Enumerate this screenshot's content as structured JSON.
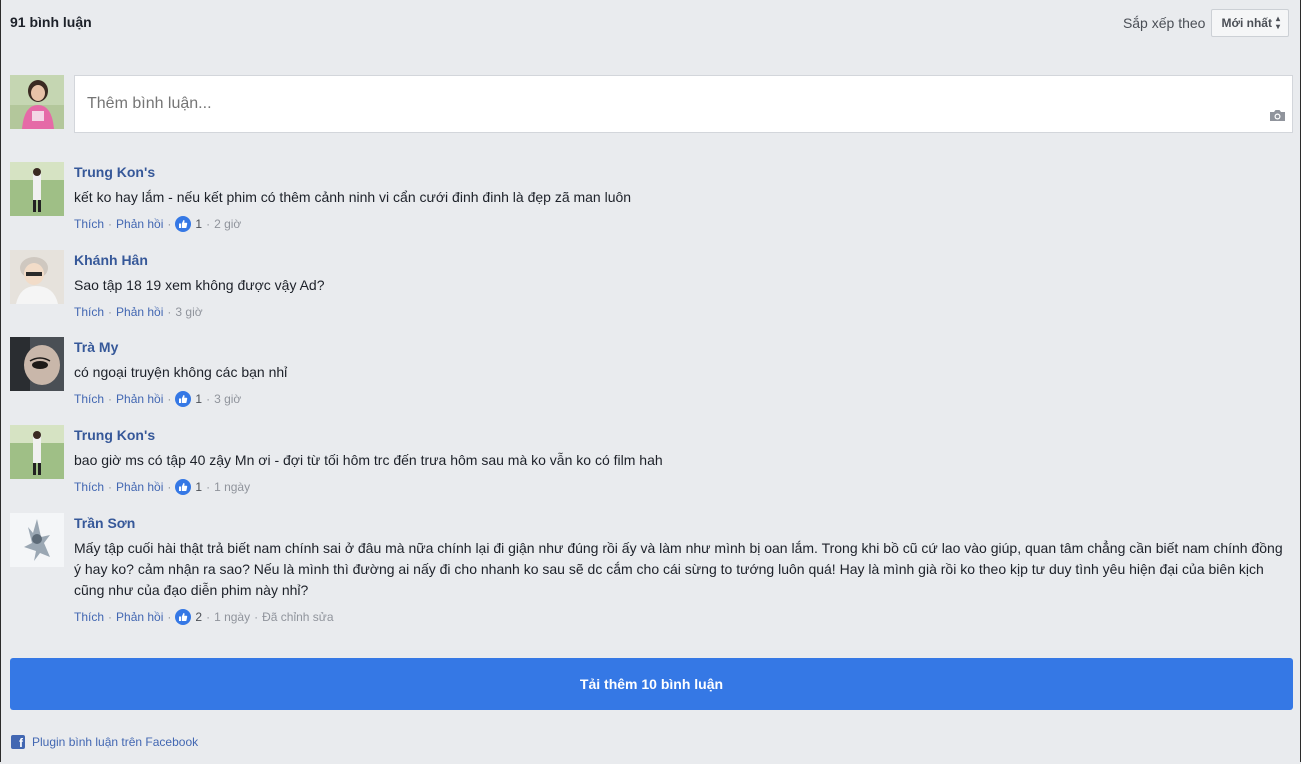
{
  "header": {
    "comment_count": "91 bình luận",
    "sort_label": "Sắp xếp theo",
    "sort_value": "Mới nhất"
  },
  "composer": {
    "placeholder": "Thêm bình luận...",
    "camera_icon": "camera-icon"
  },
  "comments": [
    {
      "name": "Trung Kon's",
      "text": "kết ko hay lắm - nếu kết phim có thêm cảnh ninh vi cẩn cưới đinh đinh là đẹp zã man luôn",
      "like": "Thích",
      "reply": "Phản hồi",
      "likes": "1",
      "time": "2 giờ"
    },
    {
      "name": "Khánh Hân",
      "text": "Sao tập 18 19 xem không được vậy Ad?",
      "like": "Thích",
      "reply": "Phản hồi",
      "time": "3 giờ"
    },
    {
      "name": "Trà My",
      "text": "có ngoại truyện không các bạn nhỉ",
      "like": "Thích",
      "reply": "Phản hồi",
      "likes": "1",
      "time": "3 giờ"
    },
    {
      "name": "Trung Kon's",
      "text": "bao giờ ms có tập 40 zậy Mn ơi - đợi từ tối hôm trc đến trưa hôm sau mà ko vẫn ko có film hah",
      "like": "Thích",
      "reply": "Phản hồi",
      "likes": "1",
      "time": "1 ngày"
    },
    {
      "name": "Trần Sơn",
      "text": "Mấy tập cuối hài thật trả biết nam chính sai ở đâu mà nữa chính lại đi giận như đúng rồi ấy và làm như mình bị oan lắm. Trong khi bồ cũ cứ lao vào giúp, quan tâm chẳng cần biết nam chính đồng ý hay ko? cảm nhận ra sao? Nếu là mình thì đường ai nấy đi cho nhanh ko sau sẽ dc cắm cho cái sừng to tướng luôn quá! Hay là mình già rồi ko theo kịp tư duy tình yêu hiện đại của biên kịch cũng như của đạo diễn phim này nhỉ?",
      "like": "Thích",
      "reply": "Phản hồi",
      "likes": "2",
      "time": "1 ngày",
      "edited": "Đã chỉnh sửa"
    }
  ],
  "load_more": "Tải thêm 10 bình luận",
  "footer": {
    "plugin_text": "Plugin bình luận trên Facebook"
  },
  "colors": {
    "accent": "#3578e5",
    "link": "#365899",
    "background": "#e9ebee"
  }
}
